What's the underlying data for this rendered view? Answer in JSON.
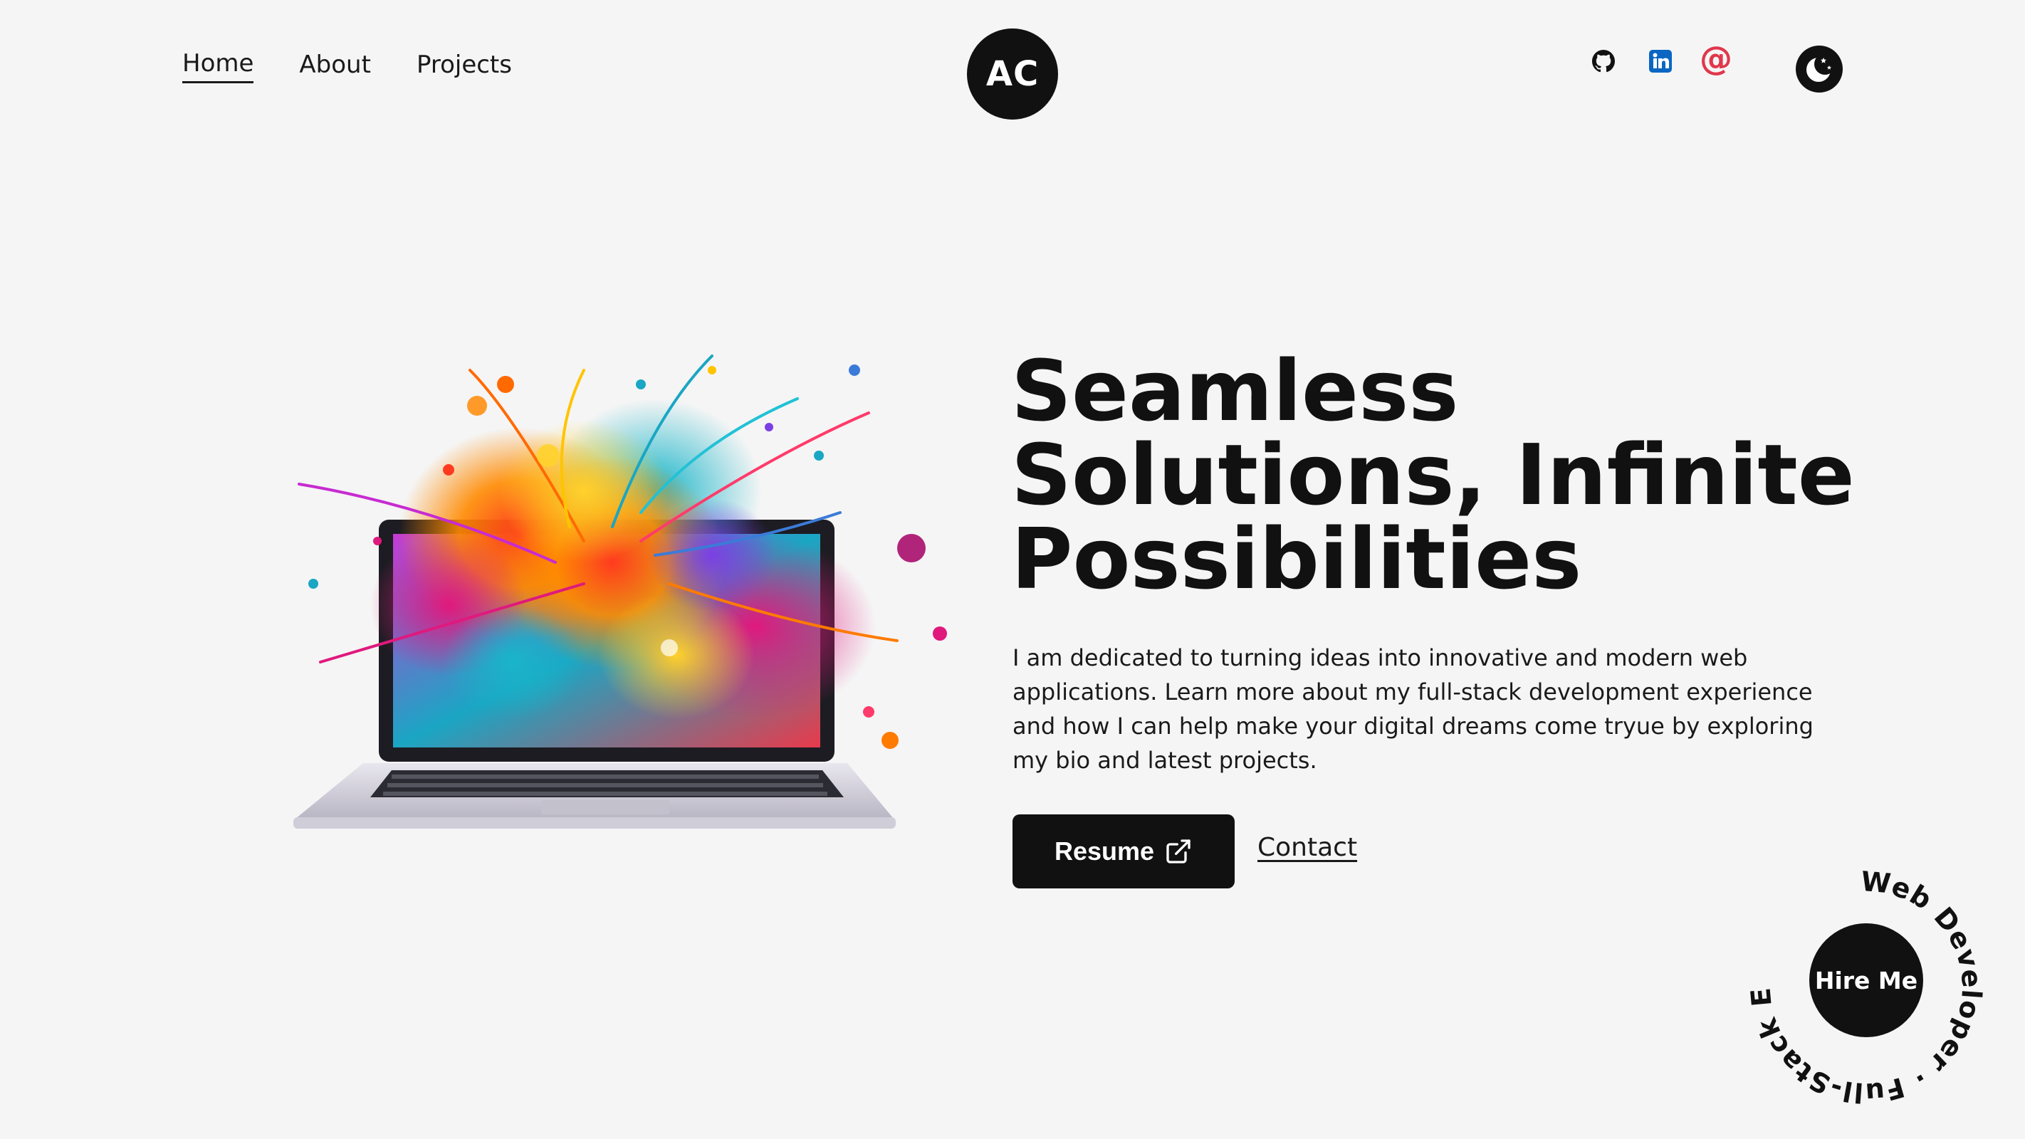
{
  "nav": {
    "links": [
      {
        "label": "Home",
        "active": true
      },
      {
        "label": "About",
        "active": false
      },
      {
        "label": "Projects",
        "active": false
      }
    ]
  },
  "logo": {
    "text": "AC"
  },
  "social": {
    "icons": [
      "github-icon",
      "linkedin-icon",
      "email-icon"
    ],
    "email_glyph": "@"
  },
  "theme_toggle": {
    "icon": "moon-icon"
  },
  "hero": {
    "headline": [
      "Seamless",
      "Solutions, Infinite",
      "Possibilities"
    ],
    "intro": "I am dedicated to turning ideas into innovative and modern web applications. Learn more about my full-stack development experience and how I can help make your digital dreams come tryue by exploring my bio and latest projects.",
    "resume_label": "Resume",
    "contact_label": "Contact"
  },
  "hire": {
    "button_label": "Hire Me",
    "ring_text": "Web Developer · Full-Stack Engineer · "
  },
  "colors": {
    "background": "#f5f5f5",
    "primary": "#111111",
    "linkedin": "#0a66c2",
    "email": "#e0374b"
  }
}
